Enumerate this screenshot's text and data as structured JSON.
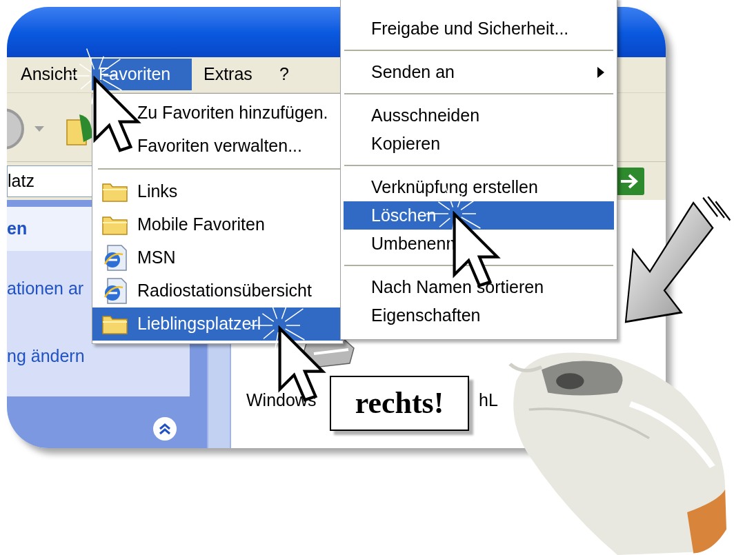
{
  "menu_bar": [
    {
      "label": "Ansicht",
      "selected": false
    },
    {
      "label": "Favoriten",
      "selected": true
    },
    {
      "label": "Extras",
      "selected": false
    },
    {
      "label": "?",
      "selected": false
    }
  ],
  "address": {
    "value": "latz"
  },
  "task_pane": {
    "heading": "en",
    "links": [
      "ationen ar",
      "ng ändern"
    ]
  },
  "favorites_menu": {
    "items": [
      {
        "kind": "command",
        "label": "Zu Favoriten hinzufügen.",
        "selected": false
      },
      {
        "kind": "command",
        "label": "Favoriten verwalten...",
        "selected": false
      },
      {
        "kind": "separator"
      },
      {
        "kind": "folder",
        "label": "Links",
        "selected": false
      },
      {
        "kind": "folder",
        "label": "Mobile Favoriten",
        "selected": false
      },
      {
        "kind": "page",
        "label": "MSN",
        "selected": false
      },
      {
        "kind": "page",
        "label": "Radiostationsübersicht",
        "selected": false
      },
      {
        "kind": "folder",
        "label": "Lieblingsplatzerl",
        "selected": true
      }
    ]
  },
  "context_menu": {
    "items": [
      {
        "kind": "command",
        "label": "Freigabe und Sicherheit...",
        "selected": false
      },
      {
        "kind": "separator"
      },
      {
        "kind": "command",
        "label": "Senden an",
        "selected": false,
        "submenu": true
      },
      {
        "kind": "separator"
      },
      {
        "kind": "command",
        "label": "Ausschneiden",
        "selected": false
      },
      {
        "kind": "command",
        "label": "Kopieren",
        "selected": false
      },
      {
        "kind": "separator"
      },
      {
        "kind": "command",
        "label": "Verknüpfung erstellen",
        "selected": false
      },
      {
        "kind": "command",
        "label": "Löschen",
        "selected": true
      },
      {
        "kind": "command",
        "label": "Umbenenn",
        "selected": false
      },
      {
        "kind": "separator"
      },
      {
        "kind": "command",
        "label": "Nach Namen sortieren",
        "selected": false
      },
      {
        "kind": "command",
        "label": "Eigenschaften",
        "selected": false
      }
    ]
  },
  "content": {
    "item_label": "Windows",
    "fragment": "hL"
  },
  "callout": "rechts!"
}
